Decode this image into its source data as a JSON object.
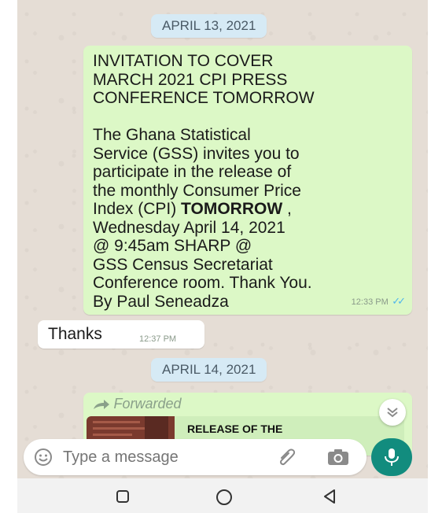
{
  "chat": {
    "date1": "APRIL 13, 2021",
    "msg1": {
      "title_line1": "INVITATION TO COVER",
      "title_line2": "MARCH 2021 CPI PRESS",
      "title_line3": "CONFERENCE TOMORROW",
      "body_line1": "The Ghana Statistical",
      "body_line2": "Service (GSS) invites you to",
      "body_line3": "participate in the release of",
      "body_line4": "the monthly Consumer Price",
      "body_line5_pre": "Index (CPI) ",
      "body_line5_bold": "TOMORROW",
      "body_line5_post": " ,",
      "body_line6": "Wednesday April 14, 2021",
      "body_line7": "@ 9:45am SHARP @",
      "body_line8": "GSS Census Secretariat",
      "body_line9": "Conference room. Thank You.",
      "body_line10": "By Paul Seneadza",
      "time": "12:33 PM",
      "ticks": "✓✓"
    },
    "msg2": {
      "text": "Thanks",
      "time": "12:37 PM"
    },
    "date2": "APRIL 14, 2021",
    "msg3": {
      "forwarded_label": "Forwarded",
      "preview_title": "RELEASE OF THE"
    }
  },
  "input": {
    "placeholder": "Type a message"
  },
  "colors": {
    "outgoing_bubble": "#dcf8c6",
    "incoming_bubble": "#ffffff",
    "date_pill": "#d6eaf5",
    "mic_button": "#128c7e",
    "read_ticks": "#4fb6ec"
  },
  "icons": {
    "emoji": "smiley-icon",
    "attach": "paperclip-icon",
    "camera": "camera-icon",
    "mic": "microphone-icon",
    "scroll": "chevron-double-down-icon",
    "nav_recents": "square-icon",
    "nav_home": "circle-icon",
    "nav_back": "triangle-back-icon"
  }
}
